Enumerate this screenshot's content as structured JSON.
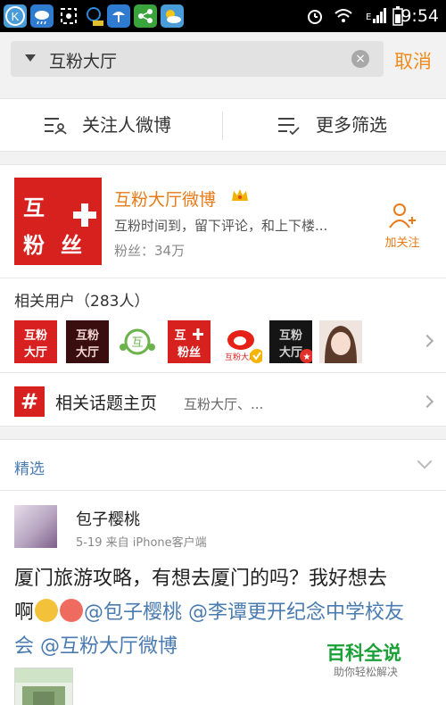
{
  "status_bar": {
    "time": "9:54",
    "icons": [
      "k-app-icon",
      "cloud-icon",
      "screenshot-icon",
      "notification-icon",
      "weather-rain-icon",
      "share-icon",
      "weather-icon",
      "alarm-icon",
      "wifi-icon",
      "signal-icon",
      "battery-icon"
    ],
    "signal_label": "E"
  },
  "search": {
    "query": "互粉大厅",
    "cancel_label": "取消"
  },
  "filters": {
    "left_label": "关注人微博",
    "right_label": "更多筛选"
  },
  "account": {
    "logo_chars": [
      "互",
      "粉",
      "丝"
    ],
    "name": "互粉大厅微博",
    "description": "互粉时间到，留下评论，和上下楼...",
    "fans": "粉丝：34万",
    "follow_label": "加关注"
  },
  "related_users": {
    "title": "相关用户（283人）"
  },
  "topic": {
    "hash": "#",
    "title": "相关话题主页",
    "subtitle": "互粉大厅、..."
  },
  "featured": {
    "label": "精选"
  },
  "post": {
    "user": "包子樱桃",
    "meta": "5-19  来自 iPhone客户端",
    "text_line1": "厦门旅游攻略，有想去厦门的吗？我好想去",
    "text_line2_start": "啊",
    "mention1": "@包子樱桃",
    "mention2": "@李谭更开纪念中学校友",
    "mention2_cont": "会",
    "mention3": "@互粉大厅微博"
  },
  "watermark": {
    "title": "百科全说",
    "subtitle": "助你轻松解决"
  },
  "colors": {
    "accent": "#f18a1d",
    "brand_red": "#d6211f",
    "link": "#4a7bb0"
  }
}
